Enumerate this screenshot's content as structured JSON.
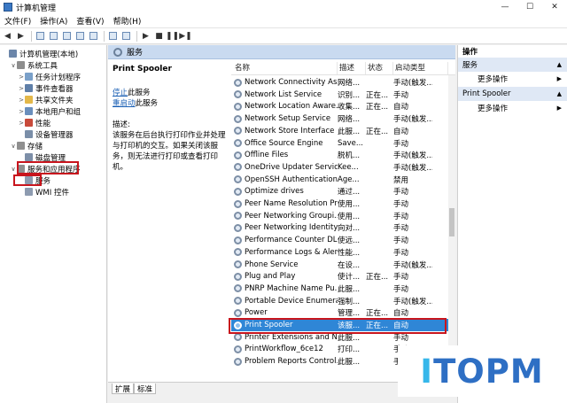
{
  "window": {
    "title": "计算机管理"
  },
  "menu": [
    "文件(F)",
    "操作(A)",
    "查看(V)",
    "帮助(H)"
  ],
  "tree": [
    {
      "label": "计算机管理(本地)",
      "indent": 0,
      "exp": "",
      "icon": "computer-icon",
      "color": "#6c86aa"
    },
    {
      "label": "系统工具",
      "indent": 1,
      "exp": "∨",
      "icon": "tools-icon",
      "color": "#8d8d8d"
    },
    {
      "label": "任务计划程序",
      "indent": 2,
      "exp": ">",
      "icon": "clock-icon",
      "color": "#7aa0c9"
    },
    {
      "label": "事件查看器",
      "indent": 2,
      "exp": ">",
      "icon": "event-viewer-icon",
      "color": "#5f7fa8"
    },
    {
      "label": "共享文件夹",
      "indent": 2,
      "exp": ">",
      "icon": "folder-icon",
      "color": "#e3b84a"
    },
    {
      "label": "本地用户和组",
      "indent": 2,
      "exp": ">",
      "icon": "users-icon",
      "color": "#6a8fbd"
    },
    {
      "label": "性能",
      "indent": 2,
      "exp": ">",
      "icon": "performance-icon",
      "color": "#c84a3a"
    },
    {
      "label": "设备管理器",
      "indent": 2,
      "exp": "",
      "icon": "device-manager-icon",
      "color": "#7a8ea8"
    },
    {
      "label": "存储",
      "indent": 1,
      "exp": "∨",
      "icon": "storage-icon",
      "color": "#8f8f8f"
    },
    {
      "label": "磁盘管理",
      "indent": 2,
      "exp": "",
      "icon": "disk-icon",
      "color": "#7d8fa8"
    },
    {
      "label": "服务和应用程序",
      "indent": 1,
      "exp": "∨",
      "icon": "services-apps-icon",
      "color": "#8f8f8f"
    },
    {
      "label": "服务",
      "indent": 2,
      "exp": "",
      "icon": "gear-icon",
      "color": "#8d9bb0"
    },
    {
      "label": "WMI 控件",
      "indent": 2,
      "exp": "",
      "icon": "wmi-icon",
      "color": "#8d9bb0"
    }
  ],
  "services_header": "服务",
  "desc": {
    "name": "Print Spooler",
    "stop_link": "停止",
    "stop_suffix": "此服务",
    "restart_link": "重启动",
    "restart_suffix": "此服务",
    "label": "描述:",
    "text": "该服务在后台执行打印作业并处理与打印机的交互。如果关闭该服务，则无法进行打印或查看打印机。"
  },
  "columns": [
    "名称",
    "描述",
    "状态",
    "启动类型"
  ],
  "rows": [
    {
      "name": "Network Connectivity Ass...",
      "desc": "网络...",
      "status": "",
      "startup": "手动(触发..."
    },
    {
      "name": "Network List Service",
      "desc": "识别...",
      "status": "正在...",
      "startup": "手动"
    },
    {
      "name": "Network Location Aware...",
      "desc": "收集...",
      "status": "正在...",
      "startup": "自动"
    },
    {
      "name": "Network Setup Service",
      "desc": "网络...",
      "status": "",
      "startup": "手动(触发..."
    },
    {
      "name": "Network Store Interface ...",
      "desc": "此服...",
      "status": "正在...",
      "startup": "自动"
    },
    {
      "name": "Office  Source Engine",
      "desc": "Save...",
      "status": "",
      "startup": "手动"
    },
    {
      "name": "Offline Files",
      "desc": "脱机...",
      "status": "",
      "startup": "手动(触发..."
    },
    {
      "name": "OneDrive Updater Service",
      "desc": "Kee...",
      "status": "",
      "startup": "手动(触发..."
    },
    {
      "name": "OpenSSH Authentication ...",
      "desc": "Age...",
      "status": "",
      "startup": "禁用"
    },
    {
      "name": "Optimize drives",
      "desc": "通过...",
      "status": "",
      "startup": "手动"
    },
    {
      "name": "Peer Name Resolution Pr...",
      "desc": "使用...",
      "status": "",
      "startup": "手动"
    },
    {
      "name": "Peer Networking Groupi...",
      "desc": "使用...",
      "status": "",
      "startup": "手动"
    },
    {
      "name": "Peer Networking Identity...",
      "desc": "向对...",
      "status": "",
      "startup": "手动"
    },
    {
      "name": "Performance Counter DL...",
      "desc": "使远...",
      "status": "",
      "startup": "手动"
    },
    {
      "name": "Performance Logs & Aler...",
      "desc": "性能...",
      "status": "",
      "startup": "手动"
    },
    {
      "name": "Phone Service",
      "desc": "在设...",
      "status": "",
      "startup": "手动(触发..."
    },
    {
      "name": "Plug and Play",
      "desc": "使计...",
      "status": "正在...",
      "startup": "手动"
    },
    {
      "name": "PNRP Machine Name Pu...",
      "desc": "此服...",
      "status": "",
      "startup": "手动"
    },
    {
      "name": "Portable Device Enumera...",
      "desc": "强制...",
      "status": "",
      "startup": "手动(触发..."
    },
    {
      "name": "Power",
      "desc": "管理...",
      "status": "正在...",
      "startup": "自动"
    },
    {
      "name": "Print Spooler",
      "desc": "该服...",
      "status": "正在...",
      "startup": "自动"
    },
    {
      "name": "Printer Extensions and N...",
      "desc": "此服...",
      "status": "",
      "startup": "手动"
    },
    {
      "name": "PrintWorkflow_6ce12",
      "desc": "打印...",
      "status": "",
      "startup": "手动"
    },
    {
      "name": "Problem Reports Control...",
      "desc": "此服...",
      "status": "",
      "startup": "手动"
    }
  ],
  "tabs": [
    "扩展",
    "标准"
  ],
  "actions": {
    "header": "操作",
    "sections": [
      {
        "title": "服务",
        "item": "更多操作"
      },
      {
        "title": "Print Spooler",
        "item": "更多操作"
      }
    ]
  },
  "watermark": "ITOPM",
  "colors": {
    "selection": "#2f86d6",
    "highlight_box": "#c8151d",
    "watermark_blue": "#2e6fc4",
    "watermark_cyan": "#36b7ea"
  }
}
